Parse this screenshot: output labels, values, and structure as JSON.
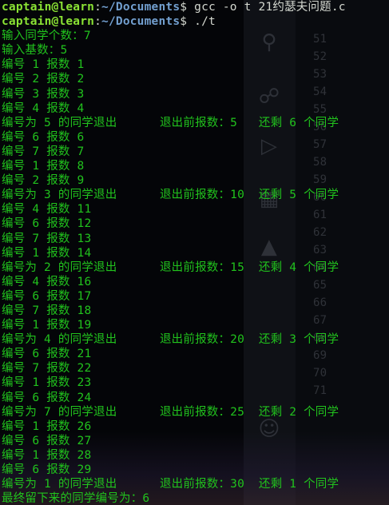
{
  "terminal": {
    "prompts": [
      {
        "user": "captain@learn",
        "sep": ":",
        "path": "~/Documents",
        "sym": "$ ",
        "command": "gcc -o t 21约瑟夫问题.c"
      },
      {
        "user": "captain@learn",
        "sep": ":",
        "path": "~/Documents",
        "sym": "$ ",
        "command": "./t"
      }
    ],
    "output": [
      "输入同学个数：7",
      "输入基数：5",
      "编号 1 报数 1",
      "编号 2 报数 2",
      "编号 3 报数 3",
      "编号 4 报数 4",
      "编号为 5 的同学退出      退出前报数：5   还剩 6 个同学",
      "编号 6 报数 6",
      "编号 7 报数 7",
      "编号 1 报数 8",
      "编号 2 报数 9",
      "编号为 3 的同学退出      退出前报数：10  还剩 5 个同学",
      "编号 4 报数 11",
      "编号 6 报数 12",
      "编号 7 报数 13",
      "编号 1 报数 14",
      "编号为 2 的同学退出      退出前报数：15  还剩 4 个同学",
      "编号 4 报数 16",
      "编号 6 报数 17",
      "编号 7 报数 18",
      "编号 1 报数 19",
      "编号为 4 的同学退出      退出前报数：20  还剩 3 个同学",
      "编号 6 报数 21",
      "编号 7 报数 22",
      "编号 1 报数 23",
      "编号 6 报数 24",
      "编号为 7 的同学退出      退出前报数：25  还剩 2 个同学",
      "编号 1 报数 26",
      "编号 6 报数 27",
      "编号 1 报数 28",
      "编号 6 报数 29",
      "编号为 1 的同学退出      退出前报数：30  还剩 1 个同学",
      "最终留下来的同学编号为：6"
    ]
  },
  "background": {
    "line_numbers": [
      "51",
      "52",
      "53",
      "54",
      "55",
      "56",
      "57",
      "58",
      "59",
      "60",
      "61",
      "62",
      "63",
      "64",
      "65",
      "66",
      "67",
      "68",
      "69",
      "70",
      "71"
    ],
    "sidebar_icons": [
      "search-icon",
      "source-control-icon",
      "run-debug-icon",
      "extensions-icon",
      "flask-icon",
      "account-icon"
    ]
  },
  "colors": {
    "output_green": "#21c21d",
    "prompt_user": "#8ae234",
    "prompt_path": "#729fcf",
    "background": "#040508"
  }
}
